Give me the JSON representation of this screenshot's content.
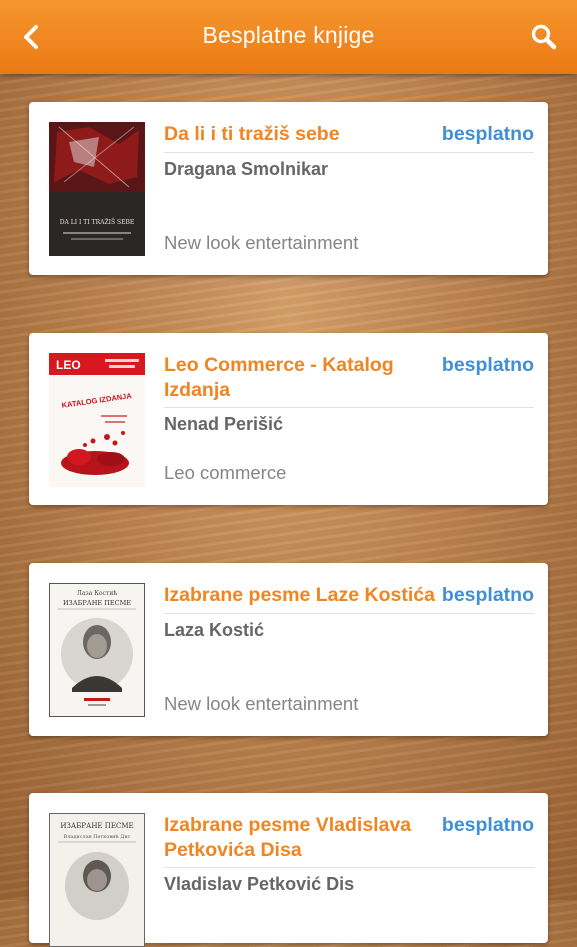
{
  "appbar": {
    "title": "Besplatne knjige",
    "back_icon": "chevron-left-icon",
    "search_icon": "search-icon",
    "color": "#f08a22"
  },
  "books": [
    {
      "title": "Da li i ti tražiš sebe",
      "price": "besplatno",
      "author": "Dragana Smolnikar",
      "publisher": "New look entertainment",
      "cover_text": "DA LI I TI TRAŽIŠ SEBE"
    },
    {
      "title": "Leo Commerce - Katalog Izdanja",
      "price": "besplatno",
      "author": "Nenad Perišić",
      "publisher": "Leo commerce",
      "cover_logo": "LEO",
      "cover_text": "KATALOG IZDANJA"
    },
    {
      "title": "Izabrane pesme Laze Kostića",
      "price": "besplatno",
      "author": "Laza Kostić",
      "publisher": "New look entertainment",
      "cover_top": "Лаза Костић",
      "cover_text": "ИЗАБРАНЕ ПЕСМЕ"
    },
    {
      "title": "Izabrane pesme Vladislava Petkovića Disa",
      "price": "besplatno",
      "author": "Vladislav Petković Dis",
      "publisher": "",
      "cover_text": "ИЗАБРАНЕ ПЕСМЕ",
      "cover_sub": "Владислав Петковић Дис"
    }
  ],
  "colors": {
    "title": "#f08522",
    "price": "#3f8fd8"
  }
}
